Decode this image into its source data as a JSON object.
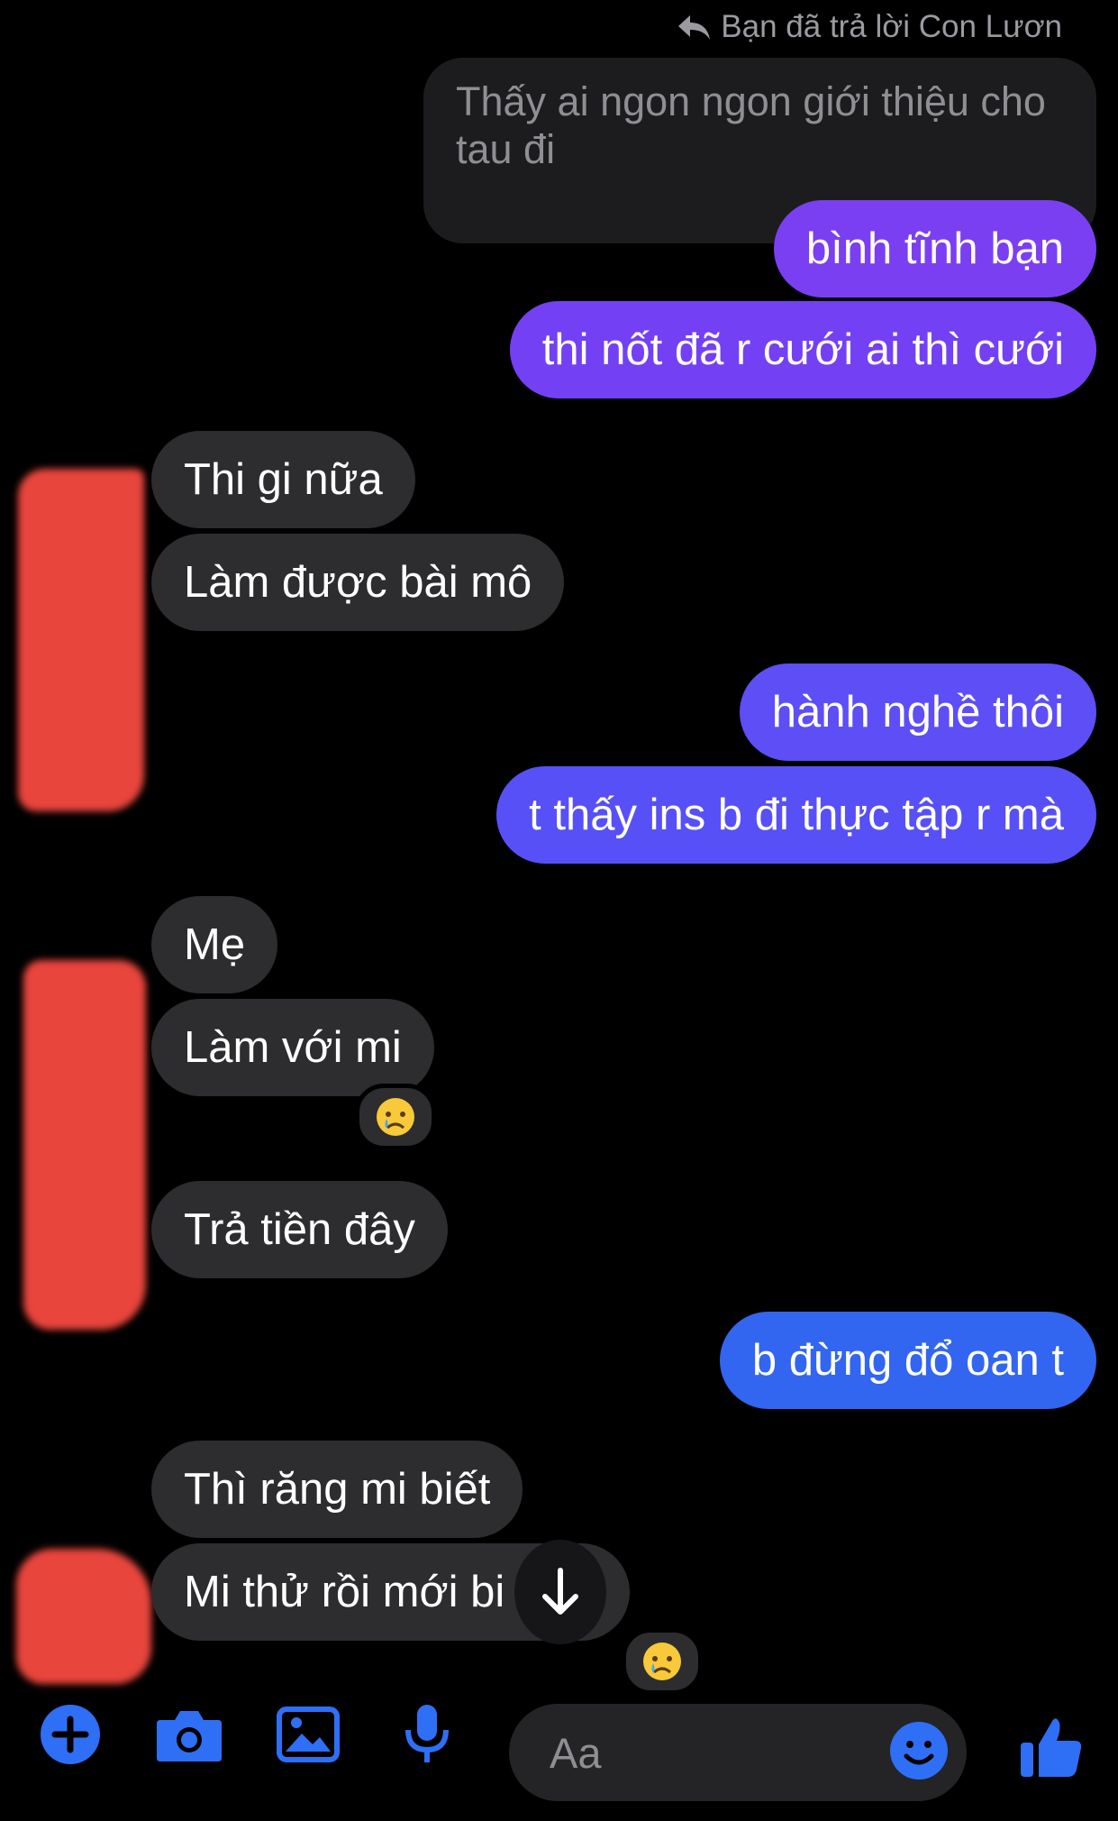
{
  "reply_header": {
    "icon": "reply-arrow-icon",
    "text": "Bạn đã trả lời Con Lươn"
  },
  "quoted_message": "Thấy ai ngon ngon giới thiệu cho tau đi",
  "messages": [
    {
      "text": "bình tĩnh bạn",
      "side": "out",
      "color": "#7b3ff2"
    },
    {
      "text": "thi nốt đã r cưới ai thì cưới",
      "side": "out",
      "color": "#7440f4"
    },
    {
      "text": "Thi gi nữa",
      "side": "in"
    },
    {
      "text": "Làm được bài mô",
      "side": "in"
    },
    {
      "text": "hành nghề thôi",
      "side": "out",
      "color": "#5e4ef5"
    },
    {
      "text": "t thấy ins b đi thực tập r mà",
      "side": "out",
      "color": "#5750f6"
    },
    {
      "text": "Mẹ",
      "side": "in"
    },
    {
      "text": "Làm với mi",
      "side": "in",
      "reaction": "😢"
    },
    {
      "text": "Trả tiền đây",
      "side": "in"
    },
    {
      "text": "b đừng đổ oan t",
      "side": "out",
      "color": "#3266f0"
    },
    {
      "text": "Thì răng mi biết",
      "side": "in"
    },
    {
      "text": "Mi thử rồi mới bi   ược",
      "side": "in",
      "reaction": "😢"
    }
  ],
  "colors": {
    "incoming": "#2d2d2f",
    "background": "#000000",
    "accent_blue": "#2f6ff5",
    "redaction": "#e8453c"
  },
  "composer": {
    "tools": [
      "plus-circle-icon",
      "camera-icon",
      "photo-icon",
      "microphone-icon"
    ],
    "placeholder": "Aa",
    "emoji_icon": "smiley-icon",
    "like_icon": "thumbs-up-icon"
  },
  "scroll_button_icon": "arrow-down-icon"
}
